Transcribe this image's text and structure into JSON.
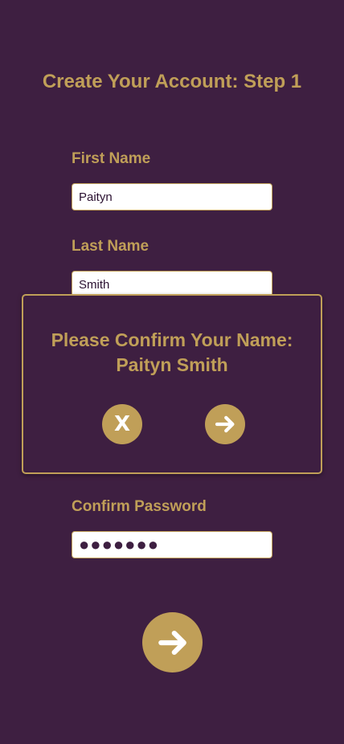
{
  "header": {
    "title": "Create Your Account: Step 1"
  },
  "form": {
    "first_name": {
      "label": "First Name",
      "value": "Paityn"
    },
    "last_name": {
      "label": "Last Name",
      "value": "Smith"
    },
    "confirm_password": {
      "label": "Confirm Password",
      "value": "●●●●●●●"
    }
  },
  "modal": {
    "title_line1": "Please Confirm Your Name:",
    "title_line2": "Paityn Smith",
    "cancel_label": "X",
    "confirm_icon": "arrow-right-icon"
  },
  "actions": {
    "next_icon": "arrow-right-icon"
  },
  "colors": {
    "background": "#3e1f41",
    "accent": "#c09f58",
    "input_background": "#ffffff"
  }
}
